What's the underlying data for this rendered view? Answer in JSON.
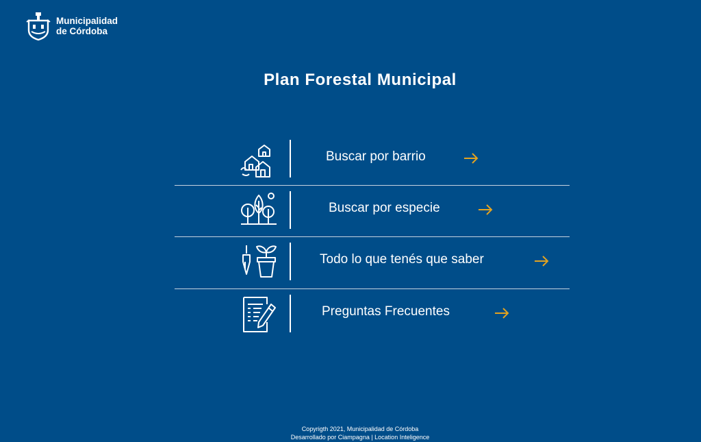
{
  "header": {
    "logo_line1": "Municipalidad",
    "logo_line2": "de Córdoba",
    "logo_icon": "municipal-crest-icon"
  },
  "title": "Plan Forestal Municipal",
  "menu": [
    {
      "label": "Buscar por barrio",
      "icon": "houses-icon",
      "arrow": "arrow-right-icon"
    },
    {
      "label": "Buscar por especie",
      "icon": "trees-icon",
      "arrow": "arrow-right-icon"
    },
    {
      "label": "Todo lo que tenés que saber",
      "icon": "plant-pot-trowel-icon",
      "arrow": "arrow-right-icon"
    },
    {
      "label": "Preguntas Frecuentes",
      "icon": "document-pencil-icon",
      "arrow": "arrow-right-icon"
    }
  ],
  "footer": {
    "line1": "Copyrigth 2021, Municipalidad de Córdoba",
    "line2": "Desarrollado por Ciampagna | Location Inteligence"
  },
  "colors": {
    "background": "#004d89",
    "accent": "#e3a320",
    "text": "#ffffff",
    "separator": "#c7d3e0"
  }
}
